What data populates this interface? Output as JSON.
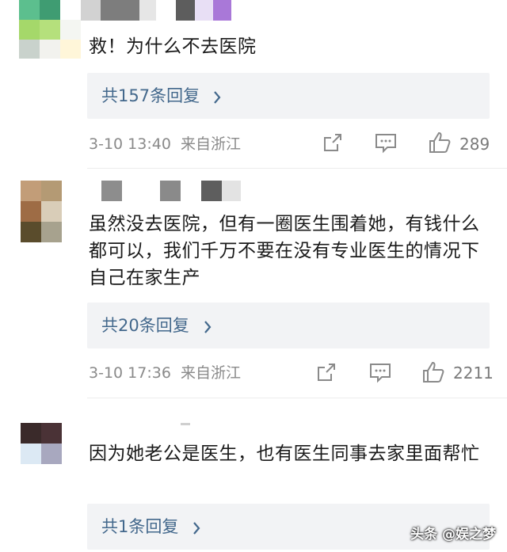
{
  "comments": [
    {
      "text": "救！为什么不去医院",
      "reply_label": "共157条回复",
      "date": "3-10 13:40",
      "location": "来自浙江",
      "likes": "289"
    },
    {
      "text": "虽然没去医院，但有一圈医生围着她，有钱什么都可以，我们千万不要在没有专业医生的情况下自己在家生产",
      "reply_label": "共20条回复",
      "date": "3-10 17:36",
      "location": "来自浙江",
      "likes": "2211"
    },
    {
      "text": "因为她老公是医生，也有医生同事去家里面帮忙",
      "reply_label": "共1条回复"
    }
  ],
  "icons": {
    "share": "share-icon",
    "comment": "comment-icon",
    "like": "thumbs-up-icon",
    "chevron": "chevron-right-icon"
  },
  "colors": {
    "link": "#43688c",
    "meta": "#8a8a8a",
    "reply_bg": "#f2f3f5"
  },
  "watermark": "头条 @娱之梦"
}
